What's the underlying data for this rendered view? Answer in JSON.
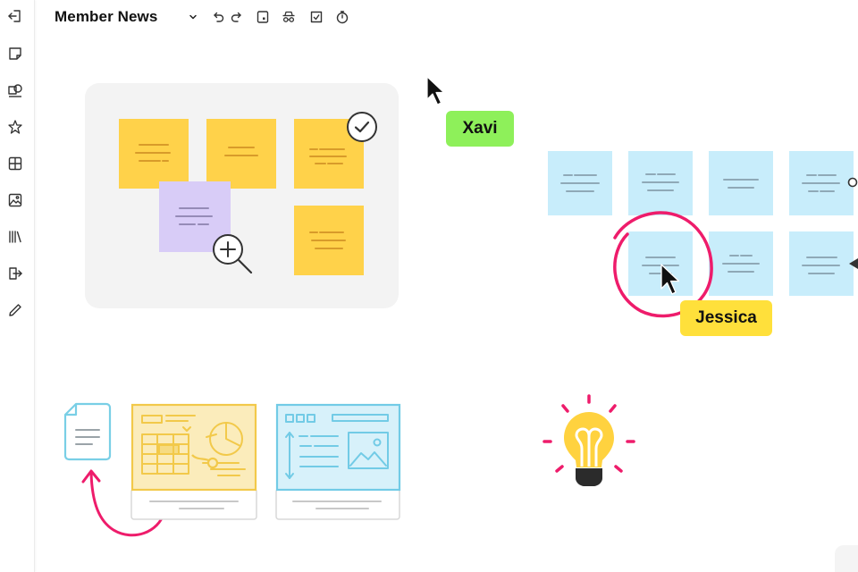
{
  "board": {
    "title": "Member News"
  },
  "collaborators": [
    {
      "name": "Xavi",
      "color": "#8ef05a"
    },
    {
      "name": "Jessica",
      "color": "#ffe03b"
    }
  ],
  "colors": {
    "sticky_yellow": "#ffd24a",
    "sticky_purple": "#d8ccf7",
    "sticky_blue": "#c8edfb",
    "highlight_pink": "#ee1c6b",
    "frame_grey": "#f3f3f3"
  },
  "left_toolbar": {
    "tools": [
      {
        "icon": "exit-icon"
      },
      {
        "icon": "sticky-note-icon"
      },
      {
        "icon": "shapes-icon"
      },
      {
        "icon": "star-icon"
      },
      {
        "icon": "grid-icon"
      },
      {
        "icon": "image-icon"
      },
      {
        "icon": "library-icon"
      },
      {
        "icon": "import-icon"
      },
      {
        "icon": "pen-icon"
      }
    ]
  },
  "top_toolbar": {
    "tools": [
      {
        "icon": "chevron-down-icon"
      },
      {
        "icon": "undo-icon"
      },
      {
        "icon": "redo-icon"
      },
      {
        "icon": "tablet-icon"
      },
      {
        "icon": "spy-icon"
      },
      {
        "icon": "select-frame-icon"
      },
      {
        "icon": "timer-icon"
      }
    ]
  }
}
